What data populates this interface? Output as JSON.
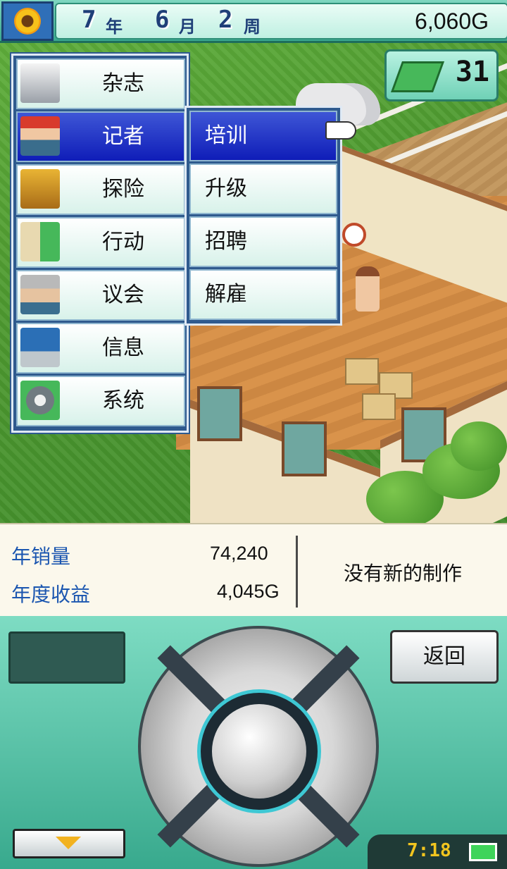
{
  "topbar": {
    "year_num": "7",
    "year_unit": "年",
    "month_num": "6",
    "month_unit": "月",
    "week_num": "2",
    "week_unit": "周",
    "money": "6,060G"
  },
  "books": {
    "count": "31"
  },
  "main_menu": {
    "items": [
      {
        "label": "杂志",
        "icon": "magazine-icon"
      },
      {
        "label": "记者",
        "icon": "reporter-icon",
        "selected": true
      },
      {
        "label": "探险",
        "icon": "treasure-chest-icon"
      },
      {
        "label": "行动",
        "icon": "money-bag-icon"
      },
      {
        "label": "议会",
        "icon": "council-elder-icon"
      },
      {
        "label": "信息",
        "icon": "computer-icon"
      },
      {
        "label": "系统",
        "icon": "gear-wrench-icon"
      }
    ]
  },
  "sub_menu": {
    "items": [
      {
        "label": "培训",
        "selected": true
      },
      {
        "label": "升级"
      },
      {
        "label": "招聘"
      },
      {
        "label": "解雇"
      }
    ]
  },
  "stats": {
    "annual_sales_label": "年销量",
    "annual_sales_value": "74,240",
    "annual_profit_label": "年度收益",
    "annual_profit_value": "4,045G",
    "no_new_production": "没有新的制作"
  },
  "controller": {
    "back_label": "返回",
    "clock": "7:18"
  },
  "colors": {
    "accent_teal": "#3aa88e",
    "menu_selected": "#0f1db8",
    "label_blue": "#1b56b0"
  }
}
